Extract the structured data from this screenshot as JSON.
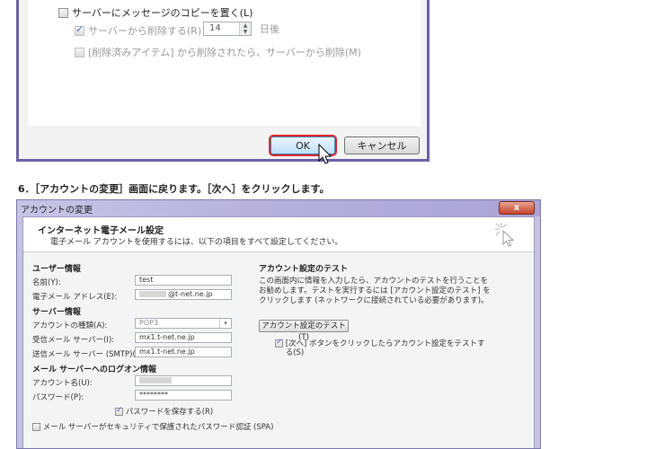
{
  "top_dialog": {
    "leave_copy_label": "サーバーにメッセージのコピーを置く(L)",
    "remove_from_server_label": "サーバーから削除する(R)",
    "days_value": "14",
    "days_suffix": "日後",
    "remove_when_deleted_label": "[削除済みアイテム] から削除されたら、サーバーから削除(M)",
    "ok_label": "OK",
    "cancel_label": "キャンセル"
  },
  "step_text": "6．［アカウントの変更］画面に戻ります。［次へ］をクリックします。",
  "account_window": {
    "title": "アカウントの変更",
    "close_label": "x",
    "header_title": "インターネット電子メール設定",
    "header_subtitle": "電子メール アカウントを使用するには、以下の項目をすべて設定してください。",
    "user_info": {
      "heading": "ユーザー情報",
      "name_label": "名前(Y):",
      "name_value": "test",
      "email_label": "電子メール アドレス(E):",
      "email_value": "@t-net.ne.jp"
    },
    "server_info": {
      "heading": "サーバー情報",
      "account_type_label": "アカウントの種類(A):",
      "account_type_value": "POP3",
      "incoming_label": "受信メール サーバー(I):",
      "incoming_value": "mx1.t-net.ne.jp",
      "outgoing_label": "送信メール サーバー (SMTP)(O):",
      "outgoing_value": "mx1.t-net.ne.jp"
    },
    "logon_info": {
      "heading": "メール サーバーへのログオン情報",
      "account_name_label": "アカウント名(U):",
      "password_label": "パスワード(P):",
      "password_value": "********",
      "save_password_label": "パスワードを保存する(R)",
      "spa_label": "メール サーバーがセキュリティで保護されたパスワード認証 (SPA)"
    },
    "test": {
      "heading": "アカウント設定のテスト",
      "description_line1": "この画面内に情報を入力したら、アカウントのテストを行うことを",
      "description_line2": "お勧めします。テストを実行するには [アカウント設定のテスト] を",
      "description_line3": "クリックします (ネットワークに接続されている必要があります)。",
      "test_button_label": "アカウント設定のテスト(T)",
      "auto_test_label_line1": "[次へ] ボタンをクリックしたらアカウント設定をテストす",
      "auto_test_label_line2": "る(S)"
    }
  },
  "colors": {
    "window_border": "#6a62a6",
    "ok_highlight": "#e2262a",
    "titlebar": "#b6b0dc"
  }
}
